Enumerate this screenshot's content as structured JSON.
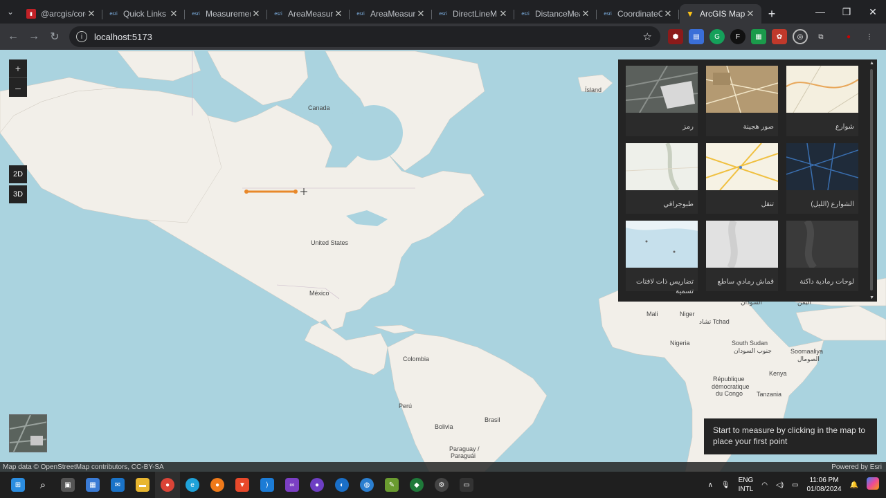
{
  "browser": {
    "tabs": [
      {
        "title": "@arcgis/core",
        "active": false,
        "favicon": "npm-icon"
      },
      {
        "title": "Quick Links |",
        "active": false,
        "favicon": "esri-icon"
      },
      {
        "title": "Measuremen",
        "active": false,
        "favicon": "esri-icon"
      },
      {
        "title": "AreaMeasure",
        "active": false,
        "favicon": "esri-icon"
      },
      {
        "title": "AreaMeasure",
        "active": false,
        "favicon": "esri-icon"
      },
      {
        "title": "DirectLineM",
        "active": false,
        "favicon": "esri-icon"
      },
      {
        "title": "DistanceMea",
        "active": false,
        "favicon": "esri-icon"
      },
      {
        "title": "CoordinateC",
        "active": false,
        "favicon": "esri-icon"
      },
      {
        "title": "ArcGIS Maps",
        "active": true,
        "favicon": "vite-icon"
      }
    ],
    "favicon_text": "esri",
    "url": "localhost:5173"
  },
  "map": {
    "labels": {
      "island": "Ísland",
      "canada": "Canada",
      "usa": "United States",
      "mexico": "México",
      "colombia": "Colombia",
      "peru": "Perú",
      "bolivia": "Bolivia",
      "brasil": "Brasil",
      "paraguay": "Paraguay /",
      "paraguay2": "Paraguái",
      "mali": "Mali",
      "niger": "Niger",
      "chad": "تشاد Tchad",
      "sudan": "السودان",
      "yemen": "اليمن",
      "nigeria": "Nigeria",
      "south_sudan": "South Sudan",
      "south_sudan_ar": "جنوب السودان",
      "somalia": "Soomaaliya",
      "somalia_ar": "الصومال",
      "drc": "République",
      "drc2": "démocratique",
      "drc3": "du Congo",
      "kenya": "Kenya",
      "tanzania": "Tanzania"
    },
    "zoom_in": "+",
    "zoom_out": "–",
    "btn_2d": "2D",
    "btn_3d": "3D",
    "measure_tip": "Start to measure by clicking in the map to place your first point",
    "attribution_left": "Map data © OpenStreetMap contributors, CC-BY-SA",
    "attribution_right": "Powered by Esri",
    "measure_line_color": "#e8882a"
  },
  "basemap_gallery": {
    "items": [
      {
        "label": "رمز",
        "thumb": "imagery-icon"
      },
      {
        "label": "صور هجينة",
        "thumb": "hybrid-icon"
      },
      {
        "label": "شوارع",
        "thumb": "streets-icon"
      },
      {
        "label": "طبوجرافي",
        "thumb": "topographic-icon"
      },
      {
        "label": "تنقل",
        "thumb": "navigation-icon"
      },
      {
        "label": "الشوارع (الليل)",
        "thumb": "streets-night-icon"
      },
      {
        "label": "تضاريس ذات لافتات تسمية",
        "thumb": "terrain-icon"
      },
      {
        "label": "قماش رمادي ساطع",
        "thumb": "light-gray-icon"
      },
      {
        "label": "لوحات رمادية داكنة",
        "thumb": "dark-gray-icon"
      }
    ]
  },
  "taskbar": {
    "lang1": "ENG",
    "lang2": "INTL",
    "time": "11:06 PM",
    "date": "01/08/2024"
  }
}
